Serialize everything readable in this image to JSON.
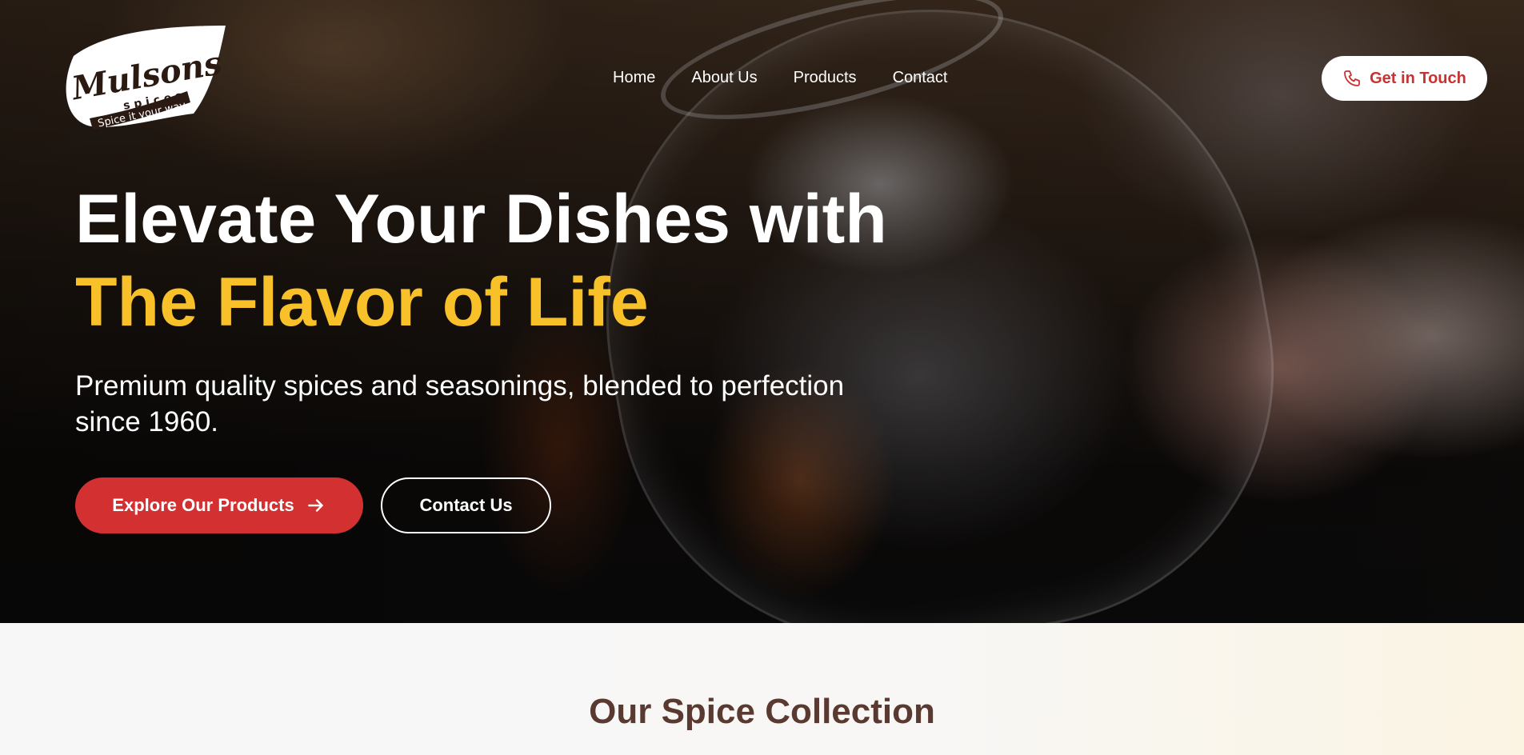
{
  "brand": {
    "name": "Mulsons",
    "subtitle": "spices",
    "tagline": "Spice it your way"
  },
  "nav": {
    "items": [
      {
        "label": "Home"
      },
      {
        "label": "About Us"
      },
      {
        "label": "Products"
      },
      {
        "label": "Contact"
      }
    ]
  },
  "header": {
    "cta_label": "Get in Touch",
    "cta_icon": "phone-icon"
  },
  "hero": {
    "headline_line1": "Elevate Your Dishes with",
    "headline_line2": "The Flavor of Life",
    "subheadline": "Premium quality spices and seasonings, blended to perfection since 1960.",
    "primary_button": "Explore Our Products",
    "primary_button_icon": "arrow-right-icon",
    "secondary_button": "Contact Us"
  },
  "collection": {
    "title": "Our Spice Collection"
  },
  "colors": {
    "accent_yellow": "#f8c12a",
    "brand_red": "#d33131",
    "heading_brown": "#5a3a30"
  }
}
